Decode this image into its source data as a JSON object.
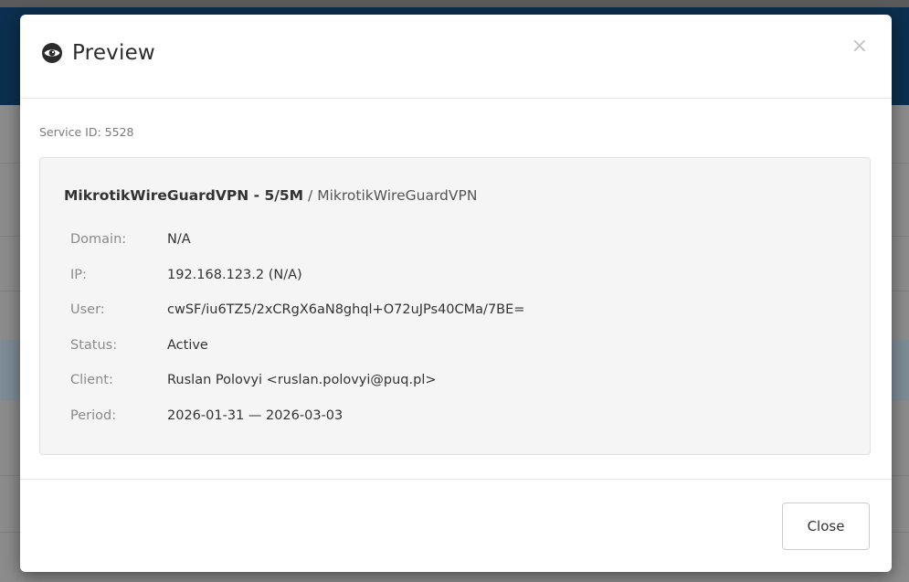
{
  "modal": {
    "title": "Preview",
    "title_icon": "eye-icon",
    "close_symbol": "×",
    "service_id_text": "Service ID: 5528",
    "product_name": "MikrotikWireGuardVPN - 5/5M",
    "product_separator": "/",
    "product_group": "MikrotikWireGuardVPN",
    "details": [
      {
        "label": "Domain:",
        "value": "N/A"
      },
      {
        "label": "IP:",
        "value": "192.168.123.2 (N/A)"
      },
      {
        "label": "User:",
        "value": "cwSF/iu6TZ5/2xCRgX6aN8ghql+O72uJPs40CMa/7BE="
      },
      {
        "label": "Status:",
        "value": "Active"
      },
      {
        "label": "Client:",
        "value": "Ruslan Polovyi <ruslan.polovyi@puq.pl>"
      },
      {
        "label": "Period:",
        "value": "2026-01-31 — 2026-03-03"
      }
    ],
    "close_button_label": "Close"
  },
  "colors": {
    "overlay_gray": "#8c8c8c",
    "navbar_blue": "#0b2f4f",
    "panel_bg": "#f5f5f5"
  }
}
